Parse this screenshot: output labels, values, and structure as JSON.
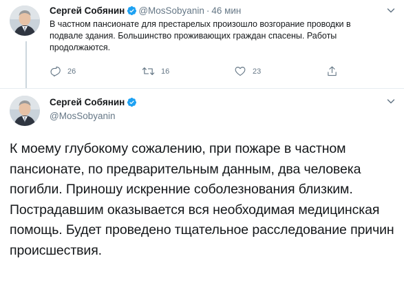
{
  "reply_tweet": {
    "author_name": "Сергей Собянин",
    "handle": "@MosSobyanin",
    "separator": "·",
    "time": "46 мин",
    "text": "В частном пансионате для престарелых произошло возгорание проводки в подвале здания. Большинство проживающих граждан спасены. Работы продолжаются.",
    "actions": {
      "reply_count": "26",
      "retweet_count": "16",
      "like_count": "23"
    }
  },
  "main_tweet": {
    "author_name": "Сергей Собянин",
    "handle": "@MosSobyanin",
    "text": "К моему глубокому сожалению, при пожаре в частном пансионате, по предварительным данным, два человека погибли. Приношу искренние соболезнования близким. Пострадавшим оказывается вся необходимая медицинская помощь. Будет проведено тщательное расследование причин происшествия."
  },
  "colors": {
    "accent": "#1da1f2",
    "muted": "#657786",
    "text": "#14171a",
    "divider": "#e6ecf0"
  },
  "icons": {
    "verified": "verified-badge-icon",
    "reply": "reply-icon",
    "retweet": "retweet-icon",
    "like": "heart-icon",
    "share": "share-icon",
    "more": "chevron-down-icon"
  }
}
